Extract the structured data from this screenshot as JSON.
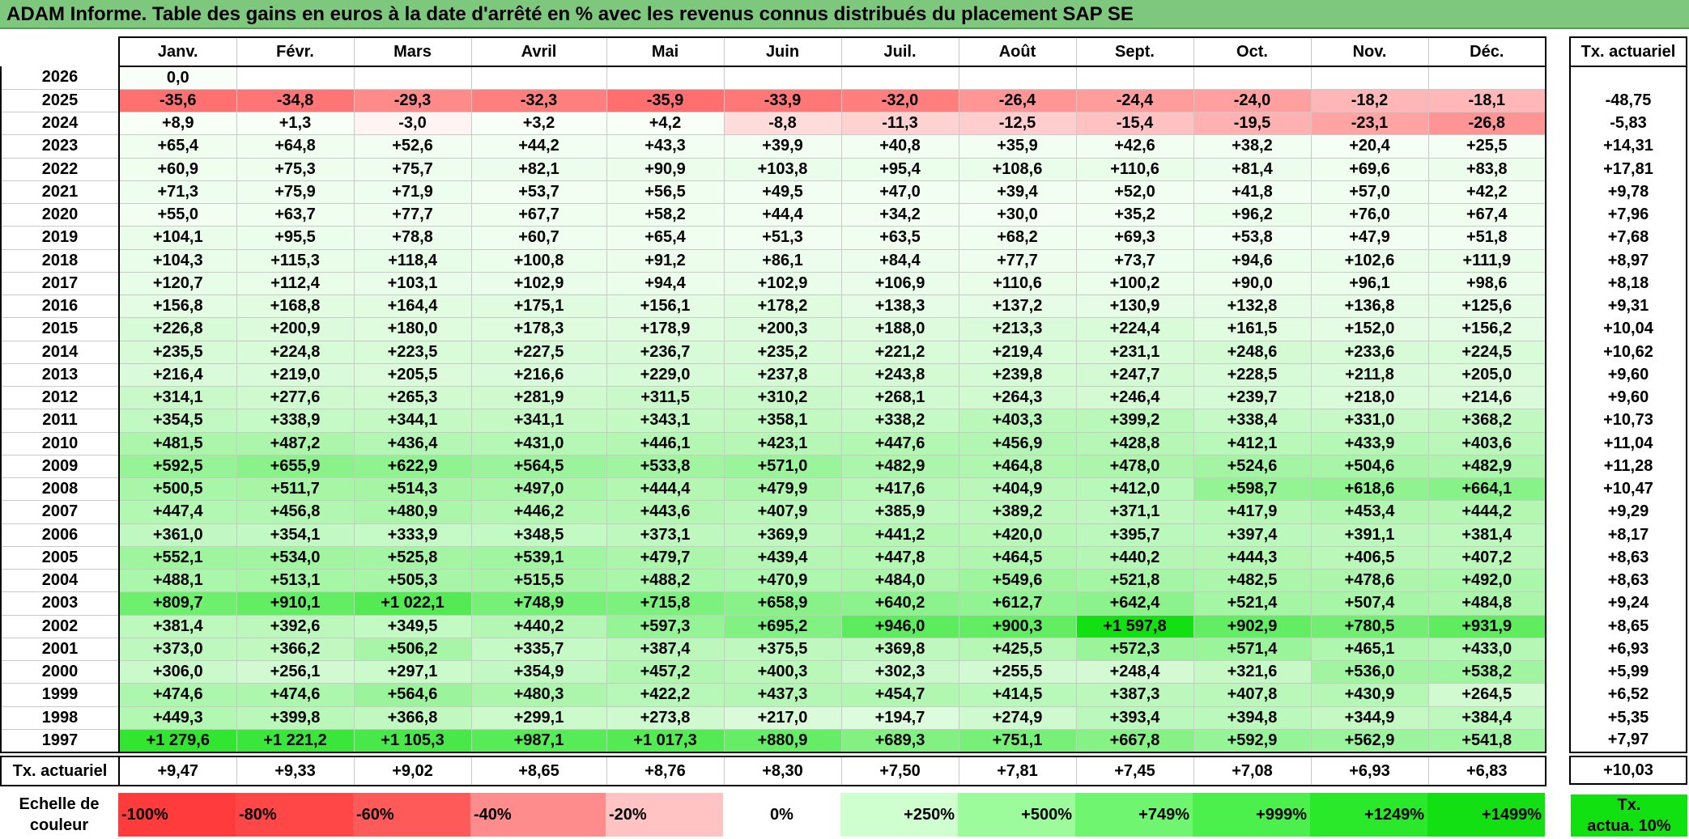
{
  "title": "ADAM Informe. Table des gains en euros à la date d'arrêté en % avec les revenus connus distribués du placement SAP SE",
  "months": [
    "Janv.",
    "Févr.",
    "Mars",
    "Avril",
    "Mai",
    "Juin",
    "Juil.",
    "Août",
    "Sept.",
    "Oct.",
    "Nov.",
    "Déc."
  ],
  "rate_header": "Tx. actuariel",
  "rows": [
    {
      "year": "2026",
      "values": [
        "0,0",
        "",
        "",
        "",
        "",
        "",
        "",
        "",
        "",
        "",
        "",
        ""
      ],
      "rate": ""
    },
    {
      "year": "2025",
      "values": [
        "-35,6",
        "-34,8",
        "-29,3",
        "-32,3",
        "-35,9",
        "-33,9",
        "-32,0",
        "-26,4",
        "-24,4",
        "-24,0",
        "-18,2",
        "-18,1"
      ],
      "rate": "-48,75"
    },
    {
      "year": "2024",
      "values": [
        "+8,9",
        "+1,3",
        "-3,0",
        "+3,2",
        "+4,2",
        "-8,8",
        "-11,3",
        "-12,5",
        "-15,4",
        "-19,5",
        "-23,1",
        "-26,8"
      ],
      "rate": "-5,83"
    },
    {
      "year": "2023",
      "values": [
        "+65,4",
        "+64,8",
        "+52,6",
        "+44,2",
        "+43,3",
        "+39,9",
        "+40,8",
        "+35,9",
        "+42,6",
        "+38,2",
        "+20,4",
        "+25,5"
      ],
      "rate": "+14,31"
    },
    {
      "year": "2022",
      "values": [
        "+60,9",
        "+75,3",
        "+75,7",
        "+82,1",
        "+90,9",
        "+103,8",
        "+95,4",
        "+108,6",
        "+110,6",
        "+81,4",
        "+69,6",
        "+83,8"
      ],
      "rate": "+17,81"
    },
    {
      "year": "2021",
      "values": [
        "+71,3",
        "+75,9",
        "+71,9",
        "+53,7",
        "+56,5",
        "+49,5",
        "+47,0",
        "+39,4",
        "+52,0",
        "+41,8",
        "+57,0",
        "+42,2"
      ],
      "rate": "+9,78"
    },
    {
      "year": "2020",
      "values": [
        "+55,0",
        "+63,7",
        "+77,7",
        "+67,7",
        "+58,2",
        "+44,4",
        "+34,2",
        "+30,0",
        "+35,2",
        "+96,2",
        "+76,0",
        "+67,4"
      ],
      "rate": "+7,96"
    },
    {
      "year": "2019",
      "values": [
        "+104,1",
        "+95,5",
        "+78,8",
        "+60,7",
        "+65,4",
        "+51,3",
        "+63,5",
        "+68,2",
        "+69,3",
        "+53,8",
        "+47,9",
        "+51,8"
      ],
      "rate": "+7,68"
    },
    {
      "year": "2018",
      "values": [
        "+104,3",
        "+115,3",
        "+118,4",
        "+100,8",
        "+91,2",
        "+86,1",
        "+84,4",
        "+77,7",
        "+73,7",
        "+94,6",
        "+102,6",
        "+111,9"
      ],
      "rate": "+8,97"
    },
    {
      "year": "2017",
      "values": [
        "+120,7",
        "+112,4",
        "+103,1",
        "+102,9",
        "+94,4",
        "+102,9",
        "+106,9",
        "+110,6",
        "+100,2",
        "+90,0",
        "+96,1",
        "+98,6"
      ],
      "rate": "+8,18"
    },
    {
      "year": "2016",
      "values": [
        "+156,8",
        "+168,8",
        "+164,4",
        "+175,1",
        "+156,1",
        "+178,2",
        "+138,3",
        "+137,2",
        "+130,9",
        "+132,8",
        "+136,8",
        "+125,6"
      ],
      "rate": "+9,31"
    },
    {
      "year": "2015",
      "values": [
        "+226,8",
        "+200,9",
        "+180,0",
        "+178,3",
        "+178,9",
        "+200,3",
        "+188,0",
        "+213,3",
        "+224,4",
        "+161,5",
        "+152,0",
        "+156,2"
      ],
      "rate": "+10,04"
    },
    {
      "year": "2014",
      "values": [
        "+235,5",
        "+224,8",
        "+223,5",
        "+227,5",
        "+236,7",
        "+235,2",
        "+221,2",
        "+219,4",
        "+231,1",
        "+248,6",
        "+233,6",
        "+224,5"
      ],
      "rate": "+10,62"
    },
    {
      "year": "2013",
      "values": [
        "+216,4",
        "+219,0",
        "+205,5",
        "+216,6",
        "+229,0",
        "+237,8",
        "+243,8",
        "+239,8",
        "+247,7",
        "+228,5",
        "+211,8",
        "+205,0"
      ],
      "rate": "+9,60"
    },
    {
      "year": "2012",
      "values": [
        "+314,1",
        "+277,6",
        "+265,3",
        "+281,9",
        "+311,5",
        "+310,2",
        "+268,1",
        "+264,3",
        "+246,4",
        "+239,7",
        "+218,0",
        "+214,6"
      ],
      "rate": "+9,60"
    },
    {
      "year": "2011",
      "values": [
        "+354,5",
        "+338,9",
        "+344,1",
        "+341,1",
        "+343,1",
        "+358,1",
        "+338,2",
        "+403,3",
        "+399,2",
        "+338,4",
        "+331,0",
        "+368,2"
      ],
      "rate": "+10,73"
    },
    {
      "year": "2010",
      "values": [
        "+481,5",
        "+487,2",
        "+436,4",
        "+431,0",
        "+446,1",
        "+423,1",
        "+447,6",
        "+456,9",
        "+428,8",
        "+412,1",
        "+433,9",
        "+403,6"
      ],
      "rate": "+11,04"
    },
    {
      "year": "2009",
      "values": [
        "+592,5",
        "+655,9",
        "+622,9",
        "+564,5",
        "+533,8",
        "+571,0",
        "+482,9",
        "+464,8",
        "+478,0",
        "+524,6",
        "+504,6",
        "+482,9"
      ],
      "rate": "+11,28"
    },
    {
      "year": "2008",
      "values": [
        "+500,5",
        "+511,7",
        "+514,3",
        "+497,0",
        "+444,4",
        "+479,9",
        "+417,6",
        "+404,9",
        "+412,0",
        "+598,7",
        "+618,6",
        "+664,1"
      ],
      "rate": "+10,47"
    },
    {
      "year": "2007",
      "values": [
        "+447,4",
        "+456,8",
        "+480,9",
        "+446,2",
        "+443,6",
        "+407,9",
        "+385,9",
        "+389,2",
        "+371,1",
        "+417,9",
        "+453,4",
        "+444,2"
      ],
      "rate": "+9,29"
    },
    {
      "year": "2006",
      "values": [
        "+361,0",
        "+354,1",
        "+333,9",
        "+348,5",
        "+373,1",
        "+369,9",
        "+441,2",
        "+420,0",
        "+395,7",
        "+397,4",
        "+391,1",
        "+381,4"
      ],
      "rate": "+8,17"
    },
    {
      "year": "2005",
      "values": [
        "+552,1",
        "+534,0",
        "+525,8",
        "+539,1",
        "+479,7",
        "+439,4",
        "+447,8",
        "+464,5",
        "+440,2",
        "+444,3",
        "+406,5",
        "+407,2"
      ],
      "rate": "+8,63"
    },
    {
      "year": "2004",
      "values": [
        "+488,1",
        "+513,1",
        "+505,3",
        "+515,5",
        "+488,2",
        "+470,9",
        "+484,0",
        "+549,6",
        "+521,8",
        "+482,5",
        "+478,6",
        "+492,0"
      ],
      "rate": "+8,63"
    },
    {
      "year": "2003",
      "values": [
        "+809,7",
        "+910,1",
        "+1 022,1",
        "+748,9",
        "+715,8",
        "+658,9",
        "+640,2",
        "+612,7",
        "+642,4",
        "+521,4",
        "+507,4",
        "+484,8"
      ],
      "rate": "+9,24"
    },
    {
      "year": "2002",
      "values": [
        "+381,4",
        "+392,6",
        "+349,5",
        "+440,2",
        "+597,3",
        "+695,2",
        "+946,0",
        "+900,3",
        "+1 597,8",
        "+902,9",
        "+780,5",
        "+931,9"
      ],
      "rate": "+8,65"
    },
    {
      "year": "2001",
      "values": [
        "+373,0",
        "+366,2",
        "+506,2",
        "+335,7",
        "+387,4",
        "+375,5",
        "+369,8",
        "+425,5",
        "+572,3",
        "+571,4",
        "+465,1",
        "+433,0"
      ],
      "rate": "+6,93"
    },
    {
      "year": "2000",
      "values": [
        "+306,0",
        "+256,1",
        "+297,1",
        "+354,9",
        "+457,2",
        "+400,3",
        "+302,3",
        "+255,5",
        "+248,4",
        "+321,6",
        "+536,0",
        "+538,2"
      ],
      "rate": "+5,99"
    },
    {
      "year": "1999",
      "values": [
        "+474,6",
        "+474,6",
        "+564,6",
        "+480,3",
        "+422,2",
        "+437,3",
        "+454,7",
        "+414,5",
        "+387,3",
        "+407,8",
        "+430,9",
        "+264,5"
      ],
      "rate": "+6,52"
    },
    {
      "year": "1998",
      "values": [
        "+449,3",
        "+399,8",
        "+366,8",
        "+299,1",
        "+273,8",
        "+217,0",
        "+194,7",
        "+274,9",
        "+393,4",
        "+394,8",
        "+344,9",
        "+384,4"
      ],
      "rate": "+5,35"
    },
    {
      "year": "1997",
      "values": [
        "+1 279,6",
        "+1 221,2",
        "+1 105,3",
        "+987,1",
        "+1 017,3",
        "+880,9",
        "+689,3",
        "+751,1",
        "+667,8",
        "+592,9",
        "+562,9",
        "+541,8"
      ],
      "rate": "+7,97"
    }
  ],
  "totals": {
    "label": "Tx. actuariel",
    "values": [
      "+9,47",
      "+9,33",
      "+9,02",
      "+8,65",
      "+8,76",
      "+8,30",
      "+7,50",
      "+7,81",
      "+7,45",
      "+7,08",
      "+6,93",
      "+6,83"
    ],
    "overall": "+10,03"
  },
  "scale": {
    "label_line1": "Echelle de",
    "label_line2": "couleur",
    "items": [
      {
        "label": "-100%",
        "color": "#ff3b3b",
        "align": "left"
      },
      {
        "label": "-80%",
        "color": "#ff4747",
        "align": "left"
      },
      {
        "label": "-60%",
        "color": "#ff5a5a",
        "align": "left"
      },
      {
        "label": "-40%",
        "color": "#ff8c8c",
        "align": "left"
      },
      {
        "label": "-20%",
        "color": "#ffc3c3",
        "align": "left"
      },
      {
        "label": "0%",
        "color": "#ffffff",
        "align": "center"
      },
      {
        "label": "+250%",
        "color": "#cfffcf",
        "align": "right"
      },
      {
        "label": "+500%",
        "color": "#9cfc9c",
        "align": "right"
      },
      {
        "label": "+749%",
        "color": "#70f570",
        "align": "right"
      },
      {
        "label": "+999%",
        "color": "#4cf04c",
        "align": "right"
      },
      {
        "label": "+1249%",
        "color": "#2ae82a",
        "align": "right"
      },
      {
        "label": "+1499%",
        "color": "#12e012",
        "align": "right"
      }
    ],
    "rate_legend_line1": "Tx.",
    "rate_legend_line2": "actua. 10%",
    "rate_legend_color": "#11e111"
  }
}
